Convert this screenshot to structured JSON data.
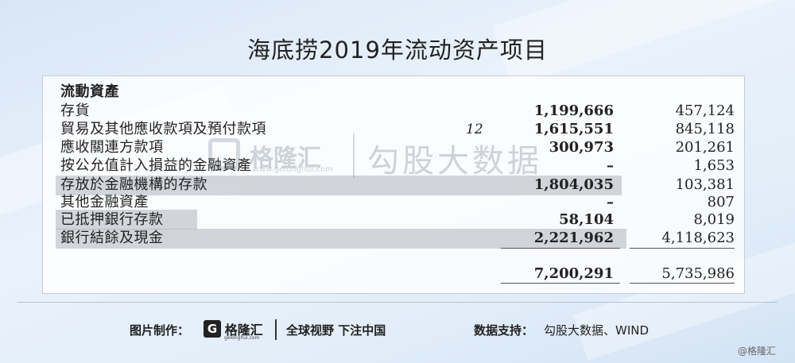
{
  "title": "海底捞2019年流动资产项目",
  "table": {
    "section_header": "流動資產",
    "rows": [
      {
        "label": "存貨",
        "note": "",
        "current": "1,199,666",
        "prior": "457,124",
        "highlight": false
      },
      {
        "label": "貿易及其他應收款項及預付款項",
        "note": "12",
        "current": "1,615,551",
        "prior": "845,118",
        "highlight": false
      },
      {
        "label": "應收關連方款項",
        "note": "",
        "current": "300,973",
        "prior": "201,261",
        "highlight": false
      },
      {
        "label": "按公允值計入損益的金融資產",
        "note": "",
        "current": "–",
        "prior": "1,653",
        "highlight": false
      },
      {
        "label": "存放於金融機構的存款",
        "note": "",
        "current": "1,804,035",
        "prior": "103,381",
        "highlight": true
      },
      {
        "label": "其他金融資產",
        "note": "",
        "current": "–",
        "prior": "807",
        "highlight": false
      },
      {
        "label": "已抵押銀行存款",
        "note": "",
        "current": "58,104",
        "prior": "8,019",
        "highlight": true
      },
      {
        "label": "銀行結餘及現金",
        "note": "",
        "current": "2,221,962",
        "prior": "4,118,623",
        "highlight": true
      }
    ],
    "total_current": "7,200,291",
    "total_prior": "5,735,986"
  },
  "watermark": {
    "brand": "格隆汇",
    "site": "www.gelonghui.com",
    "partner": "勾股大数据"
  },
  "footer": {
    "made_by_label": "图片制作：",
    "logo_letter": "G",
    "logo_text": "格隆汇",
    "logo_sub": "gelonghui.com",
    "slogan": "全球视野 下注中国",
    "source_label": "数据支持：",
    "source": "勾股大数据、WIND",
    "credit": "@格隆汇"
  }
}
